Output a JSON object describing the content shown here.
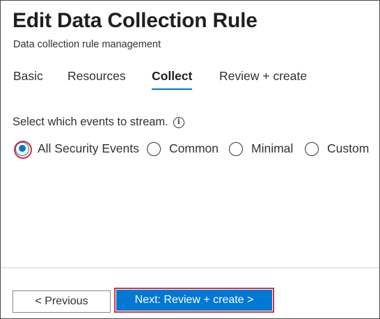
{
  "header": {
    "title": "Edit Data Collection Rule",
    "subtitle": "Data collection rule management"
  },
  "tabs": [
    {
      "label": "Basic",
      "active": false
    },
    {
      "label": "Resources",
      "active": false
    },
    {
      "label": "Collect",
      "active": true
    },
    {
      "label": "Review + create",
      "active": false
    }
  ],
  "collect": {
    "prompt": "Select which events to stream.",
    "info_icon": "info-icon",
    "options": [
      {
        "label": "All Security Events",
        "selected": true
      },
      {
        "label": "Common",
        "selected": false
      },
      {
        "label": "Minimal",
        "selected": false
      },
      {
        "label": "Custom",
        "selected": false
      }
    ]
  },
  "footer": {
    "previous_label": "< Previous",
    "next_label": "Next: Review + create >"
  },
  "colors": {
    "accent": "#0078d4",
    "highlight": "#d13438"
  }
}
